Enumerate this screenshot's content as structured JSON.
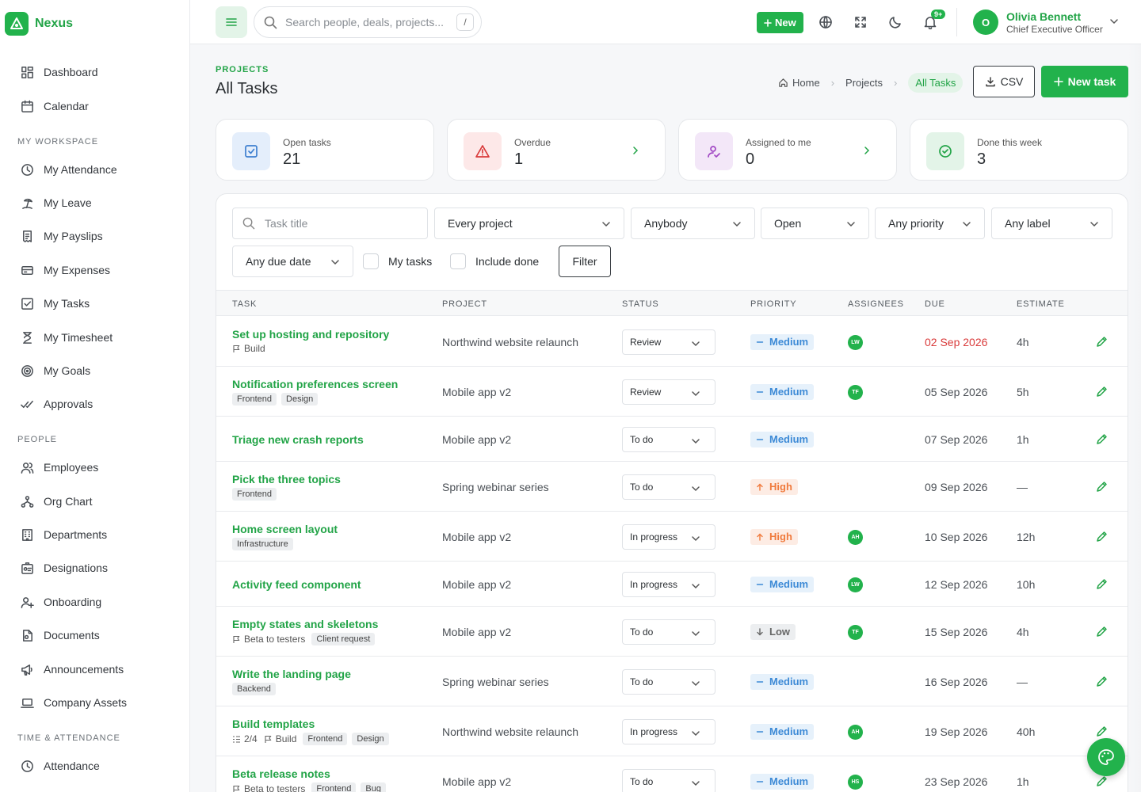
{
  "app": {
    "name": "Nexus"
  },
  "sidebar": {
    "top_items": [
      {
        "label": "Dashboard",
        "icon": "dashboard-icon"
      },
      {
        "label": "Calendar",
        "icon": "calendar-icon"
      }
    ],
    "sections": [
      {
        "title": "MY WORKSPACE",
        "items": [
          {
            "label": "My Attendance",
            "icon": "clock-icon"
          },
          {
            "label": "My Leave",
            "icon": "beach-icon"
          },
          {
            "label": "My Payslips",
            "icon": "payslip-icon"
          },
          {
            "label": "My Expenses",
            "icon": "card-icon"
          },
          {
            "label": "My Tasks",
            "icon": "checkbox-icon"
          },
          {
            "label": "My Timesheet",
            "icon": "hourglass-icon"
          },
          {
            "label": "My Goals",
            "icon": "target-icon"
          },
          {
            "label": "Approvals",
            "icon": "double-check-icon"
          }
        ]
      },
      {
        "title": "PEOPLE",
        "items": [
          {
            "label": "Employees",
            "icon": "users-icon"
          },
          {
            "label": "Org Chart",
            "icon": "org-chart-icon"
          },
          {
            "label": "Departments",
            "icon": "building-icon"
          },
          {
            "label": "Designations",
            "icon": "id-badge-icon"
          },
          {
            "label": "Onboarding",
            "icon": "user-plus-icon"
          },
          {
            "label": "Documents",
            "icon": "document-icon"
          },
          {
            "label": "Announcements",
            "icon": "megaphone-icon"
          },
          {
            "label": "Company Assets",
            "icon": "laptop-icon"
          }
        ]
      },
      {
        "title": "TIME & ATTENDANCE",
        "items": [
          {
            "label": "Attendance",
            "icon": "clock-icon"
          }
        ]
      }
    ]
  },
  "topbar": {
    "search_placeholder": "Search people, deals, projects...",
    "search_shortcut": "/",
    "new_label": "New",
    "notifications_badge": "9+",
    "user": {
      "initial": "O",
      "name": "Olivia Bennett",
      "role": "Chief Executive Officer"
    }
  },
  "page": {
    "section": "PROJECTS",
    "title": "All Tasks",
    "breadcrumb": [
      "Home",
      "Projects",
      "All Tasks"
    ],
    "csv_label": "CSV",
    "new_task_label": "New task"
  },
  "stats": [
    {
      "label": "Open tasks",
      "value": "21",
      "icon": "checkbox-icon"
    },
    {
      "label": "Overdue",
      "value": "1",
      "icon": "warning-icon"
    },
    {
      "label": "Assigned to me",
      "value": "0",
      "icon": "user-check-icon"
    },
    {
      "label": "Done this week",
      "value": "3",
      "icon": "check-circle-icon"
    }
  ],
  "filters": {
    "task_placeholder": "Task title",
    "project": "Every project",
    "assignee": "Anybody",
    "status": "Open",
    "priority": "Any priority",
    "label": "Any label",
    "due": "Any due date",
    "my_tasks_label": "My tasks",
    "include_done_label": "Include done",
    "filter_label": "Filter"
  },
  "table": {
    "columns": [
      "TASK",
      "PROJECT",
      "STATUS",
      "PRIORITY",
      "ASSIGNEES",
      "DUE",
      "ESTIMATE"
    ],
    "rows": [
      {
        "title": "Set up hosting and repository",
        "milestone": "Build",
        "subtasks": "",
        "tags": [],
        "project": "Northwind website relaunch",
        "status": "Review",
        "priority": "Medium",
        "assignee": "LW",
        "due": "02 Sep 2026",
        "overdue": true,
        "estimate": "4h"
      },
      {
        "title": "Notification preferences screen",
        "milestone": "",
        "subtasks": "",
        "tags": [
          "Frontend",
          "Design"
        ],
        "project": "Mobile app v2",
        "status": "Review",
        "priority": "Medium",
        "assignee": "TF",
        "due": "05 Sep 2026",
        "overdue": false,
        "estimate": "5h"
      },
      {
        "title": "Triage new crash reports",
        "milestone": "",
        "subtasks": "",
        "tags": [],
        "project": "Mobile app v2",
        "status": "To do",
        "priority": "Medium",
        "assignee": "",
        "due": "07 Sep 2026",
        "overdue": false,
        "estimate": "1h"
      },
      {
        "title": "Pick the three topics",
        "milestone": "",
        "subtasks": "",
        "tags": [
          "Frontend"
        ],
        "project": "Spring webinar series",
        "status": "To do",
        "priority": "High",
        "assignee": "",
        "due": "09 Sep 2026",
        "overdue": false,
        "estimate": "—"
      },
      {
        "title": "Home screen layout",
        "milestone": "",
        "subtasks": "",
        "tags": [
          "Infrastructure"
        ],
        "project": "Mobile app v2",
        "status": "In progress",
        "priority": "High",
        "assignee": "AH",
        "due": "10 Sep 2026",
        "overdue": false,
        "estimate": "12h"
      },
      {
        "title": "Activity feed component",
        "milestone": "",
        "subtasks": "",
        "tags": [],
        "project": "Mobile app v2",
        "status": "In progress",
        "priority": "Medium",
        "assignee": "LW",
        "due": "12 Sep 2026",
        "overdue": false,
        "estimate": "10h"
      },
      {
        "title": "Empty states and skeletons",
        "milestone": "Beta to testers",
        "subtasks": "",
        "tags": [
          "Client request"
        ],
        "project": "Mobile app v2",
        "status": "To do",
        "priority": "Low",
        "assignee": "TF",
        "due": "15 Sep 2026",
        "overdue": false,
        "estimate": "4h"
      },
      {
        "title": "Write the landing page",
        "milestone": "",
        "subtasks": "",
        "tags": [
          "Backend"
        ],
        "project": "Spring webinar series",
        "status": "To do",
        "priority": "Medium",
        "assignee": "",
        "due": "16 Sep 2026",
        "overdue": false,
        "estimate": "—"
      },
      {
        "title": "Build templates",
        "milestone": "Build",
        "subtasks": "2/4",
        "tags": [
          "Frontend",
          "Design"
        ],
        "project": "Northwind website relaunch",
        "status": "In progress",
        "priority": "Medium",
        "assignee": "AH",
        "due": "19 Sep 2026",
        "overdue": false,
        "estimate": "40h"
      },
      {
        "title": "Beta release notes",
        "milestone": "Beta to testers",
        "subtasks": "",
        "tags": [
          "Frontend",
          "Bug"
        ],
        "project": "Mobile app v2",
        "status": "To do",
        "priority": "Medium",
        "assignee": "HS",
        "due": "23 Sep 2026",
        "overdue": false,
        "estimate": "1h"
      }
    ]
  },
  "colors": {
    "accent": "#22b24c",
    "overdue": "#d93a3a",
    "medium": "#3d8ad6",
    "high": "#f07a3c"
  }
}
